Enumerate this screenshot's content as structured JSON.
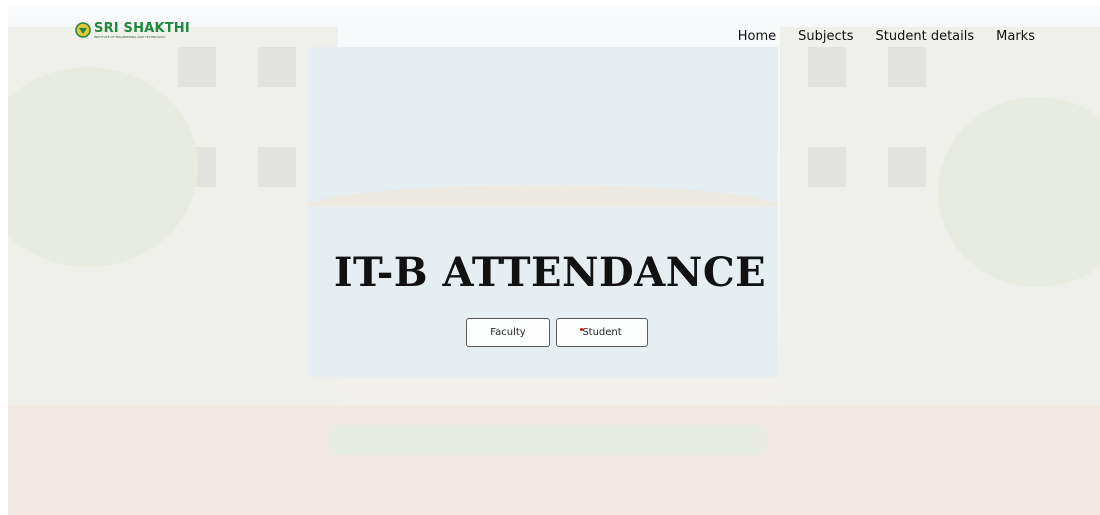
{
  "logo": {
    "title": "SRI SHAKTHI",
    "subtitle": "INSTITUTE OF ENGINEERING AND TECHNOLOGY",
    "icon": "college-emblem-icon"
  },
  "nav": {
    "items": [
      {
        "label": "Home"
      },
      {
        "label": "Subjects"
      },
      {
        "label": "Student details"
      },
      {
        "label": "Marks"
      }
    ]
  },
  "hero": {
    "title": "IT-B ATTENDANCE",
    "buttons": {
      "faculty": "Faculty",
      "student": "Student"
    }
  },
  "colors": {
    "brand_green": "#1d8a3a",
    "text": "#111111",
    "indicator_red": "#dd1111"
  }
}
